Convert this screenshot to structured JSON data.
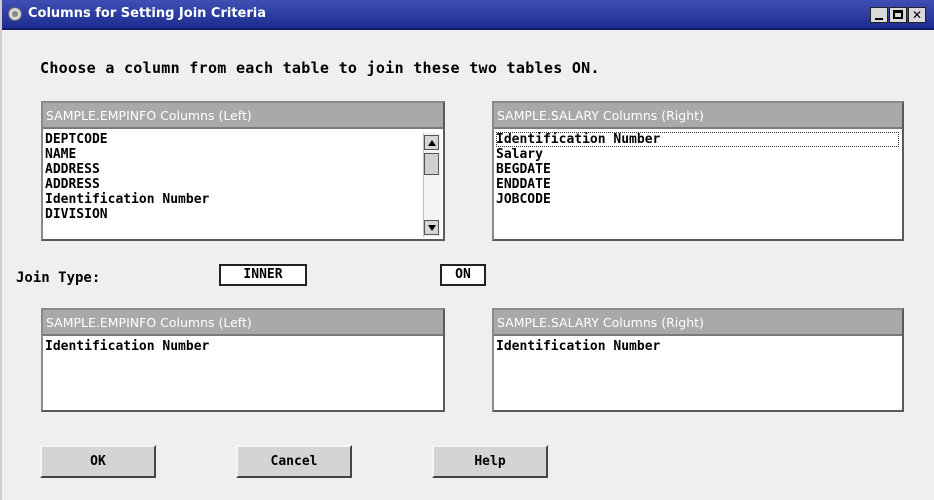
{
  "window": {
    "title": "Columns for Setting Join Criteria"
  },
  "instruction": "Choose a column from each table to join these two tables ON.",
  "left_top": {
    "header": "SAMPLE.EMPINFO Columns (Left)",
    "items": [
      "DEPTCODE",
      "NAME",
      "ADDRESS",
      "ADDRESS",
      "Identification Number",
      "DIVISION"
    ]
  },
  "right_top": {
    "header": "SAMPLE.SALARY Columns (Right)",
    "items": [
      "Identification Number",
      "Salary",
      "BEGDATE",
      "ENDDATE",
      "JOBCODE"
    ],
    "selected": "Identification Number"
  },
  "join": {
    "label": "Join Type:",
    "type_value": "INNER",
    "on_label": "ON"
  },
  "left_bottom": {
    "header": "SAMPLE.EMPINFO Columns (Left)",
    "items": [
      "Identification Number"
    ]
  },
  "right_bottom": {
    "header": "SAMPLE.SALARY Columns (Right)",
    "items": [
      "Identification Number"
    ]
  },
  "buttons": {
    "ok": "OK",
    "cancel": "Cancel",
    "help": "Help"
  }
}
